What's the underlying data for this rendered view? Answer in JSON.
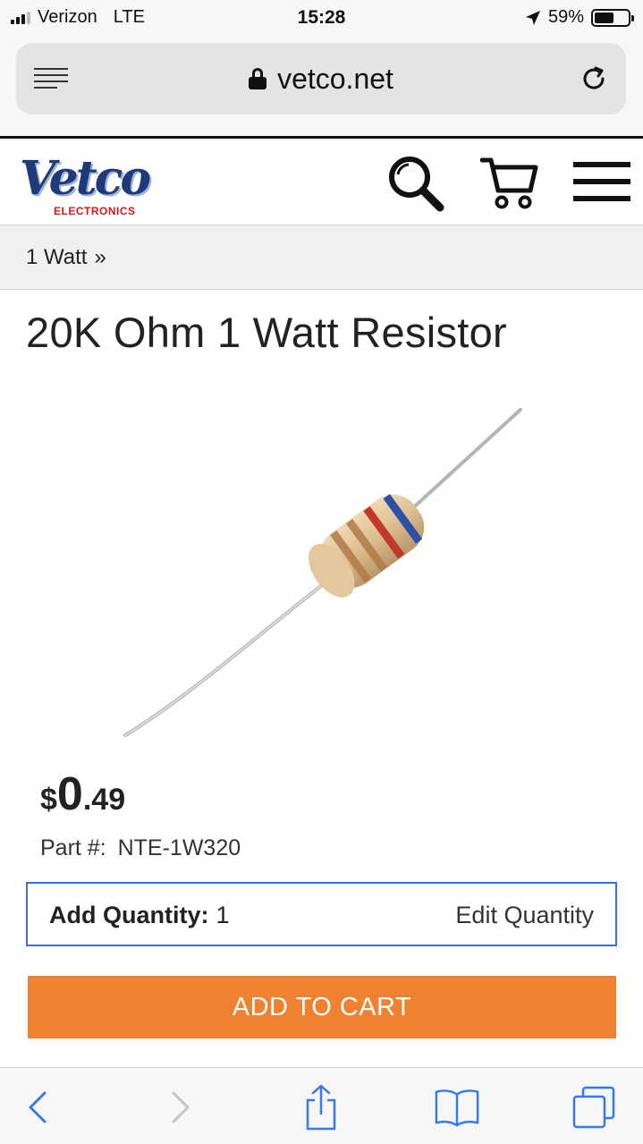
{
  "status_bar": {
    "carrier": "Verizon",
    "network": "LTE",
    "time": "15:28",
    "battery": "59%",
    "battery_level": 0.59
  },
  "browser": {
    "url": "vetco.net",
    "menu_icon": "reader-menu-icon",
    "lock_icon": "lock-icon",
    "reload_icon": "reload-icon"
  },
  "site": {
    "logo_word": "Vetco",
    "logo_subtitle": "ELECTRONICS",
    "icons": [
      "search-icon",
      "cart-icon",
      "hamburger-menu-icon"
    ]
  },
  "breadcrumb": {
    "item": "1 Watt",
    "separator": "»"
  },
  "product": {
    "title": "20K Ohm 1 Watt Resistor",
    "price_currency": "$",
    "price_whole": "0",
    "price_cents": ".49",
    "part_label": "Part #:",
    "part_number": "NTE-1W320",
    "quantity_label": "Add Quantity:",
    "quantity_value": "1",
    "edit_quantity": "Edit Quantity",
    "add_to_cart": "ADD TO CART"
  },
  "colors": {
    "accent_orange": "#ef8231",
    "border_blue": "#3b6fd8",
    "ios_blue": "#3478f6",
    "logo_blue": "#1f3a78",
    "logo_red": "#d11a1a"
  },
  "toolbar": {
    "icons": [
      "back-icon",
      "forward-icon",
      "share-icon",
      "bookmarks-icon",
      "tabs-icon"
    ]
  }
}
